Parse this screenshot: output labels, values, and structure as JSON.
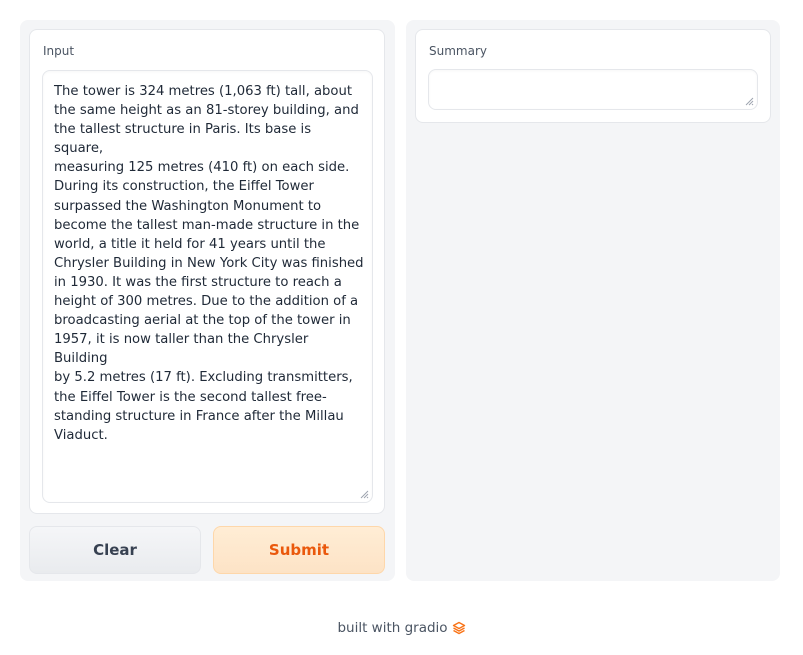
{
  "input": {
    "label": "Input",
    "value": "The tower is 324 metres (1,063 ft) tall, about\nthe same height as an 81-storey building, and\nthe tallest structure in Paris. Its base is square,\nmeasuring 125 metres (410 ft) on each side.\nDuring its construction, the Eiffel Tower\nsurpassed the Washington Monument to\nbecome the tallest man-made structure in the\nworld, a title it held for 41 years until the\nChrysler Building in New York City was finished\nin 1930. It was the first structure to reach a\nheight of 300 metres. Due to the addition of a\nbroadcasting aerial at the top of the tower in\n1957, it is now taller than the Chrysler Building\nby 5.2 metres (17 ft). Excluding transmitters,\nthe Eiffel Tower is the second tallest free-\nstanding structure in France after the Millau\nViaduct."
  },
  "buttons": {
    "clear": "Clear",
    "submit": "Submit"
  },
  "output": {
    "label": "Summary",
    "value": ""
  },
  "footer": {
    "text": "built with gradio",
    "icon": "gradio-logo-icon"
  },
  "colors": {
    "accent": "#ea580c",
    "accent_bg": "#ffedd5",
    "panel_bg": "#f4f5f7"
  }
}
